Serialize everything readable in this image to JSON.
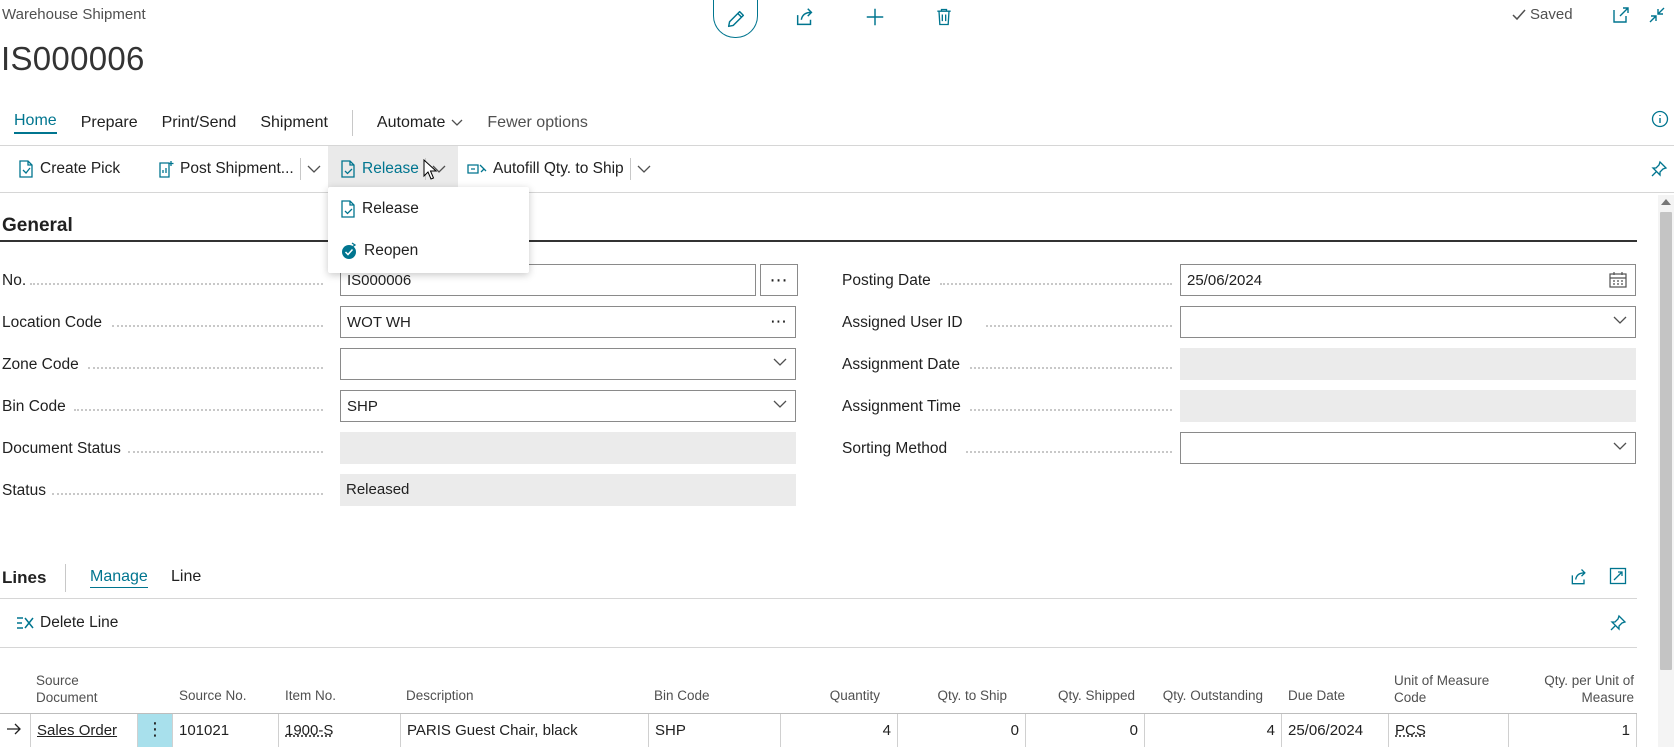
{
  "header": {
    "page_type": "Warehouse Shipment",
    "document_no": "IS000006",
    "saved_label": "Saved"
  },
  "nav": {
    "tabs": [
      "Home",
      "Prepare",
      "Print/Send",
      "Shipment"
    ],
    "automate": "Automate",
    "fewer_options": "Fewer options"
  },
  "actions": {
    "create_pick": "Create Pick",
    "post_shipment": "Post Shipment...",
    "release": "Release",
    "autofill": "Autofill Qty. to Ship"
  },
  "release_menu": {
    "items": [
      "Release",
      "Reopen"
    ]
  },
  "general": {
    "title": "General",
    "left": [
      {
        "label": "No.",
        "value": "IS000006"
      },
      {
        "label": "Location Code",
        "value": "WOT WH"
      },
      {
        "label": "Zone Code",
        "value": ""
      },
      {
        "label": "Bin Code",
        "value": "SHP"
      },
      {
        "label": "Document Status",
        "value": ""
      },
      {
        "label": "Status",
        "value": "Released"
      }
    ],
    "right": [
      {
        "label": "Posting Date",
        "value": "25/06/2024"
      },
      {
        "label": "Assigned User ID",
        "value": ""
      },
      {
        "label": "Assignment Date",
        "value": ""
      },
      {
        "label": "Assignment Time",
        "value": ""
      },
      {
        "label": "Sorting Method",
        "value": ""
      }
    ]
  },
  "lines": {
    "title": "Lines",
    "tabs": [
      "Manage",
      "Line"
    ],
    "delete_line": "Delete Line",
    "columns": {
      "source_document": "Source Document",
      "source_no": "Source No.",
      "item_no": "Item No.",
      "description": "Description",
      "bin_code": "Bin Code",
      "quantity": "Quantity",
      "qty_to_ship": "Qty. to Ship",
      "qty_shipped": "Qty. Shipped",
      "qty_outstanding": "Qty. Outstanding",
      "due_date": "Due Date",
      "uom_code": "Unit of Measure Code",
      "qty_per_uom": "Qty. per Unit of Measure"
    },
    "rows": [
      {
        "source_document": "Sales Order",
        "source_no": "101021",
        "item_no": "1900-S",
        "description": "PARIS Guest Chair, black",
        "bin_code": "SHP",
        "quantity": "4",
        "qty_to_ship": "0",
        "qty_shipped": "0",
        "qty_outstanding": "4",
        "due_date": "25/06/2024",
        "uom_code": "PCS",
        "qty_per_uom": "1"
      }
    ]
  },
  "colors": {
    "accent": "#00758f",
    "readonly_bg": "#ebebeb",
    "selected_cell": "#a8e0ec"
  }
}
